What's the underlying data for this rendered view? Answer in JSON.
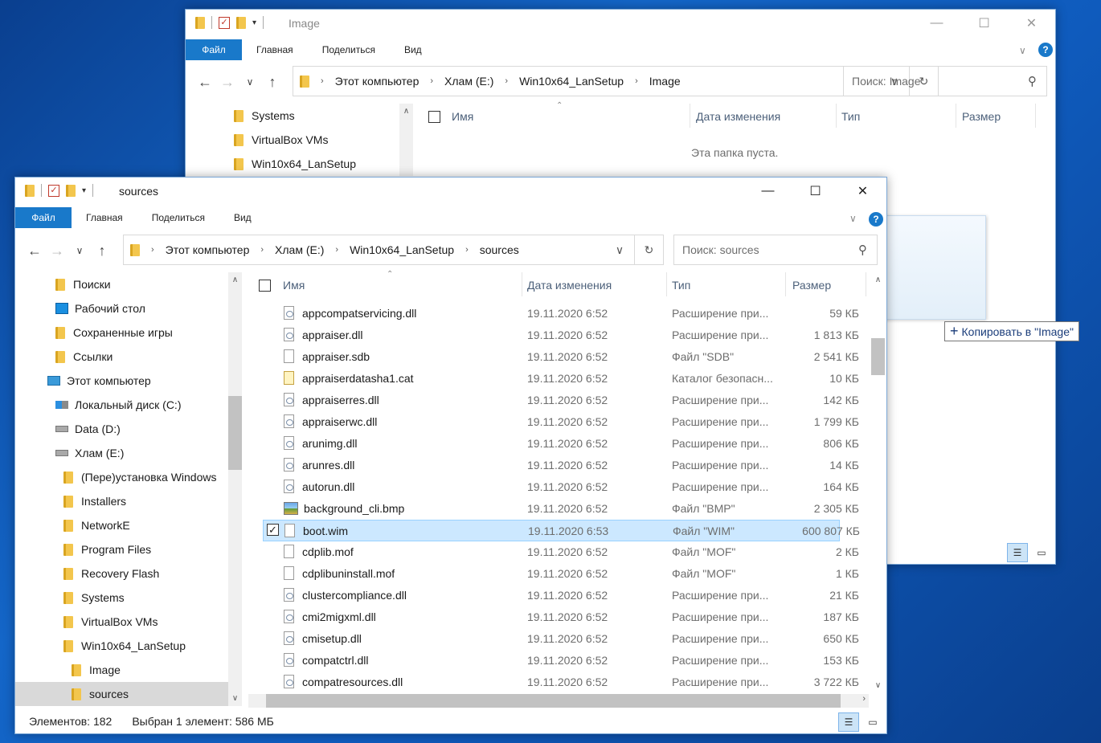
{
  "back_window": {
    "title": "Image",
    "ribbon": {
      "file": "Файл",
      "tabs": [
        "Главная",
        "Поделиться",
        "Вид"
      ]
    },
    "caption": {
      "minimize": "—",
      "maximize": "☐",
      "close": "✕"
    },
    "address": [
      "Этот компьютер",
      "Хлам (E:)",
      "Win10x64_LanSetup",
      "Image"
    ],
    "search_placeholder": "Поиск: Image",
    "nav_items": [
      "Systems",
      "VirtualBox VMs",
      "Win10x64_LanSetup"
    ],
    "columns": {
      "name": "Имя",
      "date": "Дата изменения",
      "type": "Тип",
      "size": "Размер"
    },
    "empty_text": "Эта папка пуста."
  },
  "front_window": {
    "title": "sources",
    "ribbon": {
      "file": "Файл",
      "tabs": [
        "Главная",
        "Поделиться",
        "Вид"
      ]
    },
    "caption": {
      "minimize": "—",
      "maximize": "☐",
      "close": "✕"
    },
    "address": [
      "Этот компьютер",
      "Хлам (E:)",
      "Win10x64_LanSetup",
      "sources"
    ],
    "search_placeholder": "Поиск: sources",
    "nav_items": [
      {
        "label": "Поиски",
        "icon": "folder-icon"
      },
      {
        "label": "Рабочий стол",
        "icon": "desktop-icon"
      },
      {
        "label": "Сохраненные игры",
        "icon": "folder-icon"
      },
      {
        "label": "Ссылки",
        "icon": "folder-icon"
      },
      {
        "label": "Этот компьютер",
        "icon": "computer-icon"
      },
      {
        "label": "Локальный диск (C:)",
        "icon": "windows-drive-icon"
      },
      {
        "label": "Data (D:)",
        "icon": "drive-icon"
      },
      {
        "label": "Хлам (E:)",
        "icon": "drive-icon"
      },
      {
        "label": "(Пере)установка Windows",
        "icon": "folder-icon"
      },
      {
        "label": "Installers",
        "icon": "folder-icon"
      },
      {
        "label": "NetworkE",
        "icon": "folder-icon"
      },
      {
        "label": "Program Files",
        "icon": "folder-icon"
      },
      {
        "label": "Recovery Flash",
        "icon": "folder-icon"
      },
      {
        "label": "Systems",
        "icon": "folder-icon"
      },
      {
        "label": "VirtualBox VMs",
        "icon": "folder-icon"
      },
      {
        "label": "Win10x64_LanSetup",
        "icon": "folder-icon"
      },
      {
        "label": "Image",
        "icon": "folder-icon"
      },
      {
        "label": "sources",
        "icon": "folder-icon"
      }
    ],
    "selected_nav": "sources",
    "columns": {
      "name": "Имя",
      "date": "Дата изменения",
      "type": "Тип",
      "size": "Размер"
    },
    "files": [
      {
        "name": "appcompatservicing.dll",
        "date": "19.11.2020 6:52",
        "type": "Расширение при...",
        "size": "59 КБ",
        "icon": "dll"
      },
      {
        "name": "appraiser.dll",
        "date": "19.11.2020 6:52",
        "type": "Расширение при...",
        "size": "1 813 КБ",
        "icon": "dll"
      },
      {
        "name": "appraiser.sdb",
        "date": "19.11.2020 6:52",
        "type": "Файл \"SDB\"",
        "size": "2 541 КБ",
        "icon": "file"
      },
      {
        "name": "appraiserdatasha1.cat",
        "date": "19.11.2020 6:52",
        "type": "Каталог безопасн...",
        "size": "10 КБ",
        "icon": "cat"
      },
      {
        "name": "appraiserres.dll",
        "date": "19.11.2020 6:52",
        "type": "Расширение при...",
        "size": "142 КБ",
        "icon": "dll"
      },
      {
        "name": "appraiserwc.dll",
        "date": "19.11.2020 6:52",
        "type": "Расширение при...",
        "size": "1 799 КБ",
        "icon": "dll"
      },
      {
        "name": "arunimg.dll",
        "date": "19.11.2020 6:52",
        "type": "Расширение при...",
        "size": "806 КБ",
        "icon": "dll"
      },
      {
        "name": "arunres.dll",
        "date": "19.11.2020 6:52",
        "type": "Расширение при...",
        "size": "14 КБ",
        "icon": "dll"
      },
      {
        "name": "autorun.dll",
        "date": "19.11.2020 6:52",
        "type": "Расширение при...",
        "size": "164 КБ",
        "icon": "dll"
      },
      {
        "name": "background_cli.bmp",
        "date": "19.11.2020 6:52",
        "type": "Файл \"BMP\"",
        "size": "2 305 КБ",
        "icon": "bmp"
      },
      {
        "name": "boot.wim",
        "date": "19.11.2020 6:53",
        "type": "Файл \"WIM\"",
        "size": "600 807 КБ",
        "icon": "file",
        "selected": true
      },
      {
        "name": "cdplib.mof",
        "date": "19.11.2020 6:52",
        "type": "Файл \"MOF\"",
        "size": "2 КБ",
        "icon": "file"
      },
      {
        "name": "cdplibuninstall.mof",
        "date": "19.11.2020 6:52",
        "type": "Файл \"MOF\"",
        "size": "1 КБ",
        "icon": "file"
      },
      {
        "name": "clustercompliance.dll",
        "date": "19.11.2020 6:52",
        "type": "Расширение при...",
        "size": "21 КБ",
        "icon": "dll"
      },
      {
        "name": "cmi2migxml.dll",
        "date": "19.11.2020 6:52",
        "type": "Расширение при...",
        "size": "187 КБ",
        "icon": "dll"
      },
      {
        "name": "cmisetup.dll",
        "date": "19.11.2020 6:52",
        "type": "Расширение при...",
        "size": "650 КБ",
        "icon": "dll"
      },
      {
        "name": "compatctrl.dll",
        "date": "19.11.2020 6:52",
        "type": "Расширение при...",
        "size": "153 КБ",
        "icon": "dll"
      },
      {
        "name": "compatresources.dll",
        "date": "19.11.2020 6:52",
        "type": "Расширение при...",
        "size": "3 722 КБ",
        "icon": "dll"
      }
    ],
    "status": {
      "count": "Элементов: 182",
      "selection": "Выбран 1 элемент: 586 МБ"
    }
  },
  "drag_tooltip": {
    "text": "Копировать в \"Image\""
  },
  "colors": {
    "accent": "#1979ca",
    "selection": "#cce8ff",
    "desktop": "#0f5bbd"
  }
}
